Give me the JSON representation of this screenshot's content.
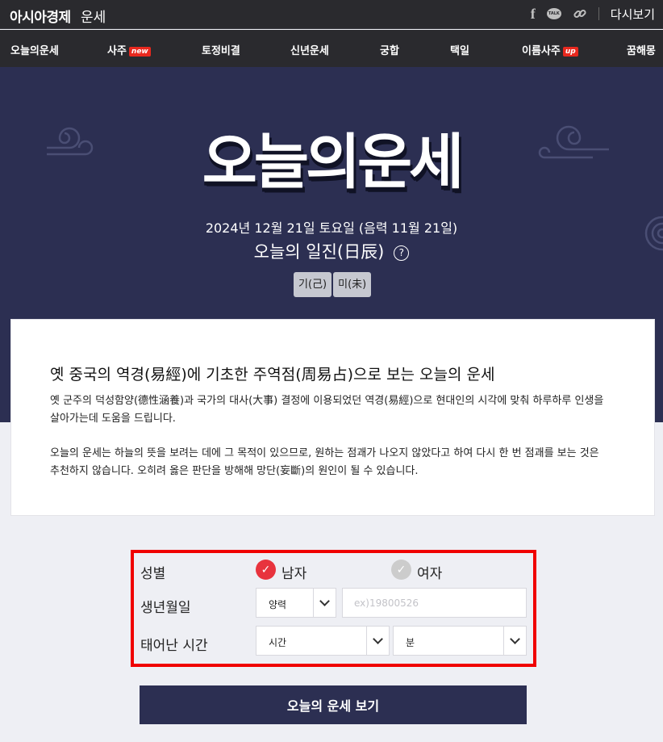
{
  "header": {
    "brand": "아시아경제",
    "section": "운세",
    "icons": [
      "facebook-icon",
      "kakaotalk-icon",
      "link-icon"
    ],
    "talk_label": "TALK",
    "reload_label": "다시보기"
  },
  "nav": {
    "items": [
      {
        "label": "오늘의운세",
        "badge": ""
      },
      {
        "label": "사주",
        "badge": "new"
      },
      {
        "label": "토정비결",
        "badge": ""
      },
      {
        "label": "신년운세",
        "badge": ""
      },
      {
        "label": "궁합",
        "badge": ""
      },
      {
        "label": "택일",
        "badge": ""
      },
      {
        "label": "이름사주",
        "badge": "up"
      },
      {
        "label": "꿈해몽",
        "badge": ""
      }
    ]
  },
  "hero": {
    "title": "오늘의운세",
    "date": "2024년 12월 21일 토요일 (음력 11월 21일)",
    "ilgin_label": "오늘의 일진(日辰)",
    "help": "?",
    "chips": [
      "기(己)",
      "미(未)"
    ]
  },
  "intro": {
    "title": "옛 중국의 역경(易經)에 기초한 주역점(周易占)으로 보는 오늘의 운세",
    "p1_line1": "옛 군주의 덕성함양(德性涵養)과 국가의 대사(大事) 결정에 이용되었던 역경(易經)으로 현대인의 시각에 맞춰 하루하루 인생을",
    "p1_line2": "살아가는데 도움을 드립니다.",
    "p2_line1": "오늘의 운세는 하늘의 뜻을 보려는 데에 그 목적이 있으므로, 원하는 점괘가 나오지 않았다고 하여 다시 한 번 점괘를 보는 것은",
    "p2_line2": "추천하지 않습니다. 오히려 옳은 판단을 방해해 망단(妄斷)의 원인이 될 수 있습니다."
  },
  "form": {
    "gender_label": "성별",
    "male": "남자",
    "female": "여자",
    "selected_gender": "남자",
    "birth_label": "생년월일",
    "calendar_value": "양력",
    "birth_placeholder": "ex)19800526",
    "time_label": "태어난 시간",
    "hour_value": "시간",
    "minute_value": "분",
    "submit": "오늘의 운세 보기",
    "colors": {
      "selected": "#e8333d",
      "unselected": "#cccccc",
      "highlight": "#f00000"
    }
  }
}
